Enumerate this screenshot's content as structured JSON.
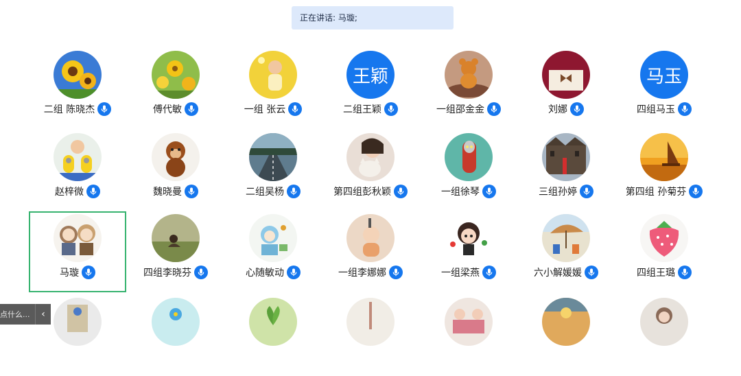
{
  "banner": {
    "text": "正在讲话: 马璇;"
  },
  "participants": [
    {
      "name": "二组 陈晓杰",
      "avatar": "sunflower-icon",
      "text": ""
    },
    {
      "name": "傅代敏",
      "avatar": "flowers-icon",
      "text": ""
    },
    {
      "name": "一组 张云",
      "avatar": "child-photo-icon",
      "text": ""
    },
    {
      "name": "二组王颖",
      "avatar": "text-avatar",
      "text": "王颖"
    },
    {
      "name": "一组邵金金",
      "avatar": "teddy-bear-icon",
      "text": ""
    },
    {
      "name": "刘娜",
      "avatar": "bow-icon",
      "text": ""
    },
    {
      "name": "四组马玉",
      "avatar": "text-avatar",
      "text": "马玉"
    },
    {
      "name": "赵梓微",
      "avatar": "minion-photo-icon",
      "text": ""
    },
    {
      "name": "魏晓曼",
      "avatar": "monkey-icon",
      "text": ""
    },
    {
      "name": "二组吴杨",
      "avatar": "road-icon",
      "text": ""
    },
    {
      "name": "第四组彭秋颖",
      "avatar": "cat-icon",
      "text": ""
    },
    {
      "name": "一组徐琴",
      "avatar": "ultraman-icon",
      "text": ""
    },
    {
      "name": "三组孙婷",
      "avatar": "building-icon",
      "text": ""
    },
    {
      "name": "第四组 孙菊芬",
      "avatar": "sailboat-icon",
      "text": ""
    },
    {
      "name": "马璇",
      "avatar": "cartoon-couple-icon",
      "text": ""
    },
    {
      "name": "四组李晓芬",
      "avatar": "meadow-icon",
      "text": ""
    },
    {
      "name": "心随敏动",
      "avatar": "doodle-icon",
      "text": ""
    },
    {
      "name": "一组李娜娜",
      "avatar": "baby-icon",
      "text": ""
    },
    {
      "name": "一组梁燕",
      "avatar": "cartoon-girl-icon",
      "text": ""
    },
    {
      "name": "六小解媛媛",
      "avatar": "beach-icon",
      "text": ""
    },
    {
      "name": "四组王璐",
      "avatar": "strawberry-icon",
      "text": ""
    },
    {
      "name": "",
      "avatar": "toy-icon",
      "text": ""
    },
    {
      "name": "",
      "avatar": "blue-flower-icon",
      "text": ""
    },
    {
      "name": "",
      "avatar": "sprout-icon",
      "text": ""
    },
    {
      "name": "",
      "avatar": "tower-icon",
      "text": ""
    },
    {
      "name": "",
      "avatar": "group-photo-icon",
      "text": ""
    },
    {
      "name": "",
      "avatar": "sunset-icon",
      "text": ""
    },
    {
      "name": "",
      "avatar": "portrait-icon",
      "text": ""
    }
  ],
  "selected_participant": "马璇",
  "collapse_bar": {
    "text": "点什么...",
    "arrow": "‹"
  },
  "colors": {
    "accent": "#1677ee",
    "selected_border": "#36b36f",
    "banner_bg": "#dde9fb"
  }
}
